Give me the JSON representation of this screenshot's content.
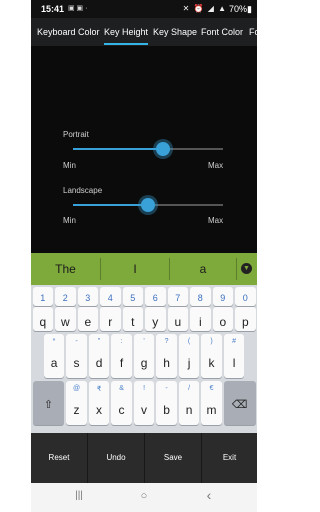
{
  "status_bar": {
    "time": "15:41",
    "left_icons": "▣ ▣ ·",
    "right_icons": "✕ ⏰ ◢ ▲",
    "battery": "70%▮"
  },
  "tabs": [
    {
      "label": "Keyboard Color",
      "active": false
    },
    {
      "label": "Key Height",
      "active": true
    },
    {
      "label": "Key Shape",
      "active": false
    },
    {
      "label": "Font Color",
      "active": false
    },
    {
      "label": "Fo",
      "active": false
    }
  ],
  "settings": {
    "portrait": {
      "label": "Portrait",
      "min_label": "Min",
      "max_label": "Max",
      "value": 0.6
    },
    "landscape": {
      "label": "Landscape",
      "min_label": "Min",
      "max_label": "Max",
      "value": 0.5
    }
  },
  "suggestions": [
    "The",
    "I",
    "a"
  ],
  "keyboard": {
    "rows": [
      [
        {
          "main": "1",
          "hint": ""
        },
        {
          "main": "2",
          "hint": ""
        },
        {
          "main": "3",
          "hint": ""
        },
        {
          "main": "4",
          "hint": ""
        },
        {
          "main": "5",
          "hint": ""
        },
        {
          "main": "6",
          "hint": ""
        },
        {
          "main": "7",
          "hint": ""
        },
        {
          "main": "8",
          "hint": ""
        },
        {
          "main": "9",
          "hint": ""
        },
        {
          "main": "0",
          "hint": ""
        }
      ],
      [
        {
          "main": "q",
          "hint": ""
        },
        {
          "main": "w",
          "hint": ""
        },
        {
          "main": "e",
          "hint": ""
        },
        {
          "main": "r",
          "hint": ""
        },
        {
          "main": "t",
          "hint": ""
        },
        {
          "main": "y",
          "hint": ""
        },
        {
          "main": "u",
          "hint": ""
        },
        {
          "main": "i",
          "hint": ""
        },
        {
          "main": "o",
          "hint": ""
        },
        {
          "main": "p",
          "hint": ""
        }
      ],
      [
        {
          "main": "a",
          "hint": "*"
        },
        {
          "main": "s",
          "hint": "-"
        },
        {
          "main": "d",
          "hint": "\""
        },
        {
          "main": "f",
          "hint": ":"
        },
        {
          "main": "g",
          "hint": "'"
        },
        {
          "main": "h",
          "hint": "?"
        },
        {
          "main": "j",
          "hint": "("
        },
        {
          "main": "k",
          "hint": ")"
        },
        {
          "main": "l",
          "hint": "#"
        }
      ],
      [
        {
          "main": "z",
          "hint": "@"
        },
        {
          "main": "x",
          "hint": "₹"
        },
        {
          "main": "c",
          "hint": "&"
        },
        {
          "main": "v",
          "hint": "!"
        },
        {
          "main": "b",
          "hint": "-"
        },
        {
          "main": "n",
          "hint": "/"
        },
        {
          "main": "m",
          "hint": "€"
        }
      ]
    ],
    "shift_symbol": "⇧",
    "backspace_symbol": "⌫"
  },
  "actions": [
    {
      "label": "Reset"
    },
    {
      "label": "Undo"
    },
    {
      "label": "Save"
    },
    {
      "label": "Exit"
    }
  ],
  "nav": {
    "recent": "|||",
    "home": "○",
    "back": "‹"
  }
}
